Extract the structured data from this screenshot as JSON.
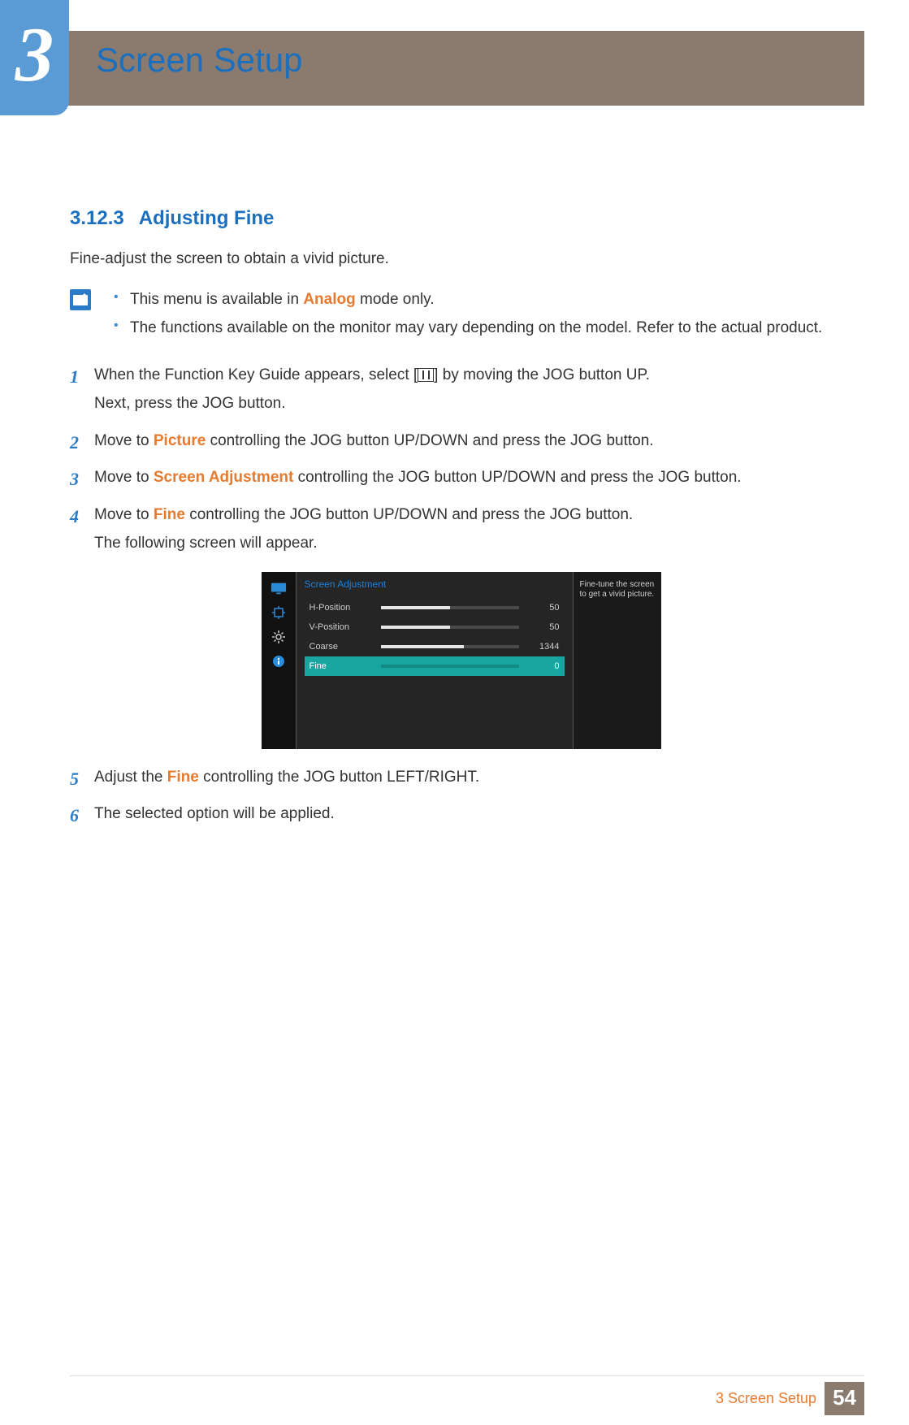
{
  "chapter": {
    "number": "3",
    "title": "Screen Setup"
  },
  "section": {
    "number": "3.12.3",
    "title": "Adjusting Fine"
  },
  "intro": "Fine-adjust the screen to obtain a vivid picture.",
  "notes": {
    "items": [
      {
        "pre": "This menu is available in ",
        "hl": "Analog",
        "post": " mode only."
      },
      {
        "text": "The functions available on the monitor may vary depending on the model. Refer to the actual product."
      }
    ]
  },
  "steps": [
    {
      "n": "1",
      "lines": [
        {
          "segments": [
            {
              "t": "When the Function Key Guide appears, select ["
            },
            {
              "icon": "menu"
            },
            {
              "t": "] by moving the JOG button UP."
            }
          ]
        },
        {
          "segments": [
            {
              "t": "Next, press the JOG button."
            }
          ]
        }
      ]
    },
    {
      "n": "2",
      "lines": [
        {
          "segments": [
            {
              "t": "Move to "
            },
            {
              "hl": "Picture"
            },
            {
              "t": " controlling the JOG button UP/DOWN and press the JOG button."
            }
          ]
        }
      ]
    },
    {
      "n": "3",
      "lines": [
        {
          "segments": [
            {
              "t": "Move to "
            },
            {
              "hl": "Screen Adjustment"
            },
            {
              "t": " controlling the JOG button UP/DOWN and press the JOG button."
            }
          ]
        }
      ]
    },
    {
      "n": "4",
      "lines": [
        {
          "segments": [
            {
              "t": "Move to "
            },
            {
              "hl": "Fine"
            },
            {
              "t": " controlling the JOG button UP/DOWN and press the JOG button."
            }
          ]
        },
        {
          "segments": [
            {
              "t": "The following screen will appear."
            }
          ]
        }
      ]
    },
    {
      "n": "5",
      "lines": [
        {
          "segments": [
            {
              "t": "Adjust the "
            },
            {
              "hl": "Fine"
            },
            {
              "t": " controlling the JOG button LEFT/RIGHT."
            }
          ]
        }
      ]
    },
    {
      "n": "6",
      "lines": [
        {
          "segments": [
            {
              "t": "The selected option will be applied."
            }
          ]
        }
      ]
    }
  ],
  "osd": {
    "title": "Screen Adjustment",
    "help": "Fine-tune the screen to get a vivid picture.",
    "rows": [
      {
        "label": "H-Position",
        "value": "50",
        "fill": 50,
        "selected": false
      },
      {
        "label": "V-Position",
        "value": "50",
        "fill": 50,
        "selected": false
      },
      {
        "label": "Coarse",
        "value": "1344",
        "fill": 60,
        "selected": false
      },
      {
        "label": "Fine",
        "value": "0",
        "fill": 0,
        "selected": true
      }
    ]
  },
  "footer": {
    "title": "3 Screen Setup",
    "page": "54"
  }
}
